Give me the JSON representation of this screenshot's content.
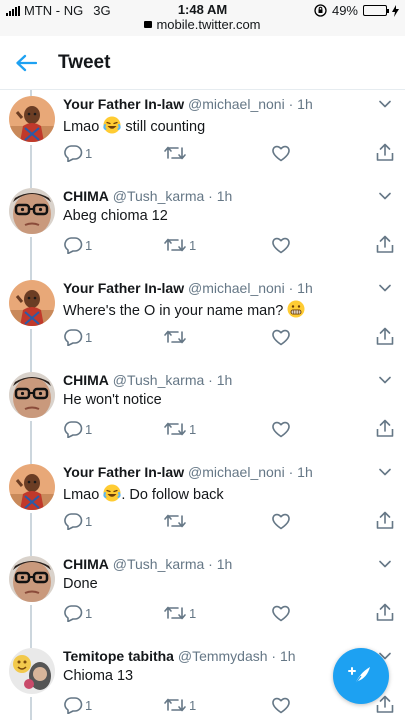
{
  "status_bar": {
    "carrier": "MTN - NG",
    "network": "3G",
    "time": "1:48 AM",
    "url": "mobile.twitter.com",
    "battery": "49%",
    "battery_level": 0.49
  },
  "header": {
    "title": "Tweet"
  },
  "colors": {
    "accent": "#1da1f2",
    "muted": "#657786",
    "thread_line": "#ccd6dd"
  },
  "tweets": [
    {
      "name": "Your Father In-law",
      "handle": "@michael_noni",
      "time": "1h",
      "text_before": "Lmao ",
      "emoji": "joy-emoji",
      "text_after": " still counting",
      "replies": "1",
      "retweets": "",
      "avatar": "avatar-baby"
    },
    {
      "name": "CHIMA",
      "handle": "@Tush_karma",
      "time": "1h",
      "text_before": "Abeg chioma 12",
      "emoji": "",
      "text_after": "",
      "replies": "1",
      "retweets": "1",
      "avatar": "avatar-glasses"
    },
    {
      "name": "Your Father In-law",
      "handle": "@michael_noni",
      "time": "1h",
      "text_before": "Where's the O in your name man? ",
      "emoji": "grimace-emoji",
      "text_after": "",
      "replies": "1",
      "retweets": "",
      "avatar": "avatar-baby"
    },
    {
      "name": "CHIMA",
      "handle": "@Tush_karma",
      "time": "1h",
      "text_before": "He won't notice",
      "emoji": "",
      "text_after": "",
      "replies": "1",
      "retweets": "1",
      "avatar": "avatar-glasses"
    },
    {
      "name": "Your Father In-law",
      "handle": "@michael_noni",
      "time": "1h",
      "text_before": "Lmao ",
      "emoji": "joy-emoji",
      "text_after": ". Do follow back",
      "replies": "1",
      "retweets": "",
      "avatar": "avatar-baby"
    },
    {
      "name": "CHIMA",
      "handle": "@Tush_karma",
      "time": "1h",
      "text_before": "Done",
      "emoji": "",
      "text_after": "",
      "replies": "1",
      "retweets": "1",
      "avatar": "avatar-glasses"
    },
    {
      "name": "Temitope tabitha",
      "handle": "@Temmydash",
      "time": "1h",
      "text_before": "Chioma 13",
      "emoji": "",
      "text_after": "",
      "replies": "1",
      "retweets": "1",
      "avatar": "avatar-stickers"
    }
  ],
  "fab": {
    "icon": "compose-tweet-icon"
  }
}
